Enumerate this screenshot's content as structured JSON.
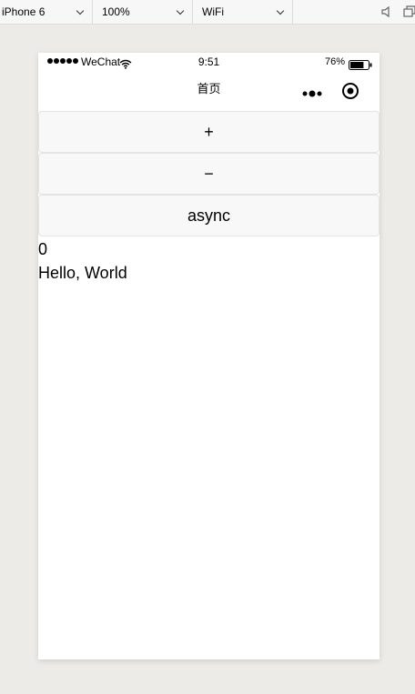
{
  "toolbar": {
    "device": "iPhone 6",
    "zoom": "100%",
    "network": "WiFi"
  },
  "statusbar": {
    "carrier": "WeChat",
    "time": "9:51",
    "battery": "76%",
    "battery_level": 0.76
  },
  "navbar": {
    "title": "首页"
  },
  "buttons": {
    "increment": "+",
    "decrement": "−",
    "async": "async"
  },
  "content": {
    "count": "0",
    "greeting": "Hello, World"
  },
  "icons": {
    "sound": "speaker-mute-icon",
    "window": "window-icon",
    "more": "more-dots-icon",
    "close": "record-close-icon",
    "wifi": "wifi-icon",
    "battery": "battery-icon"
  },
  "colors": {
    "background": "#edebe7",
    "button_bg": "#f8f8f8",
    "button_border": "#e4e4e4"
  }
}
